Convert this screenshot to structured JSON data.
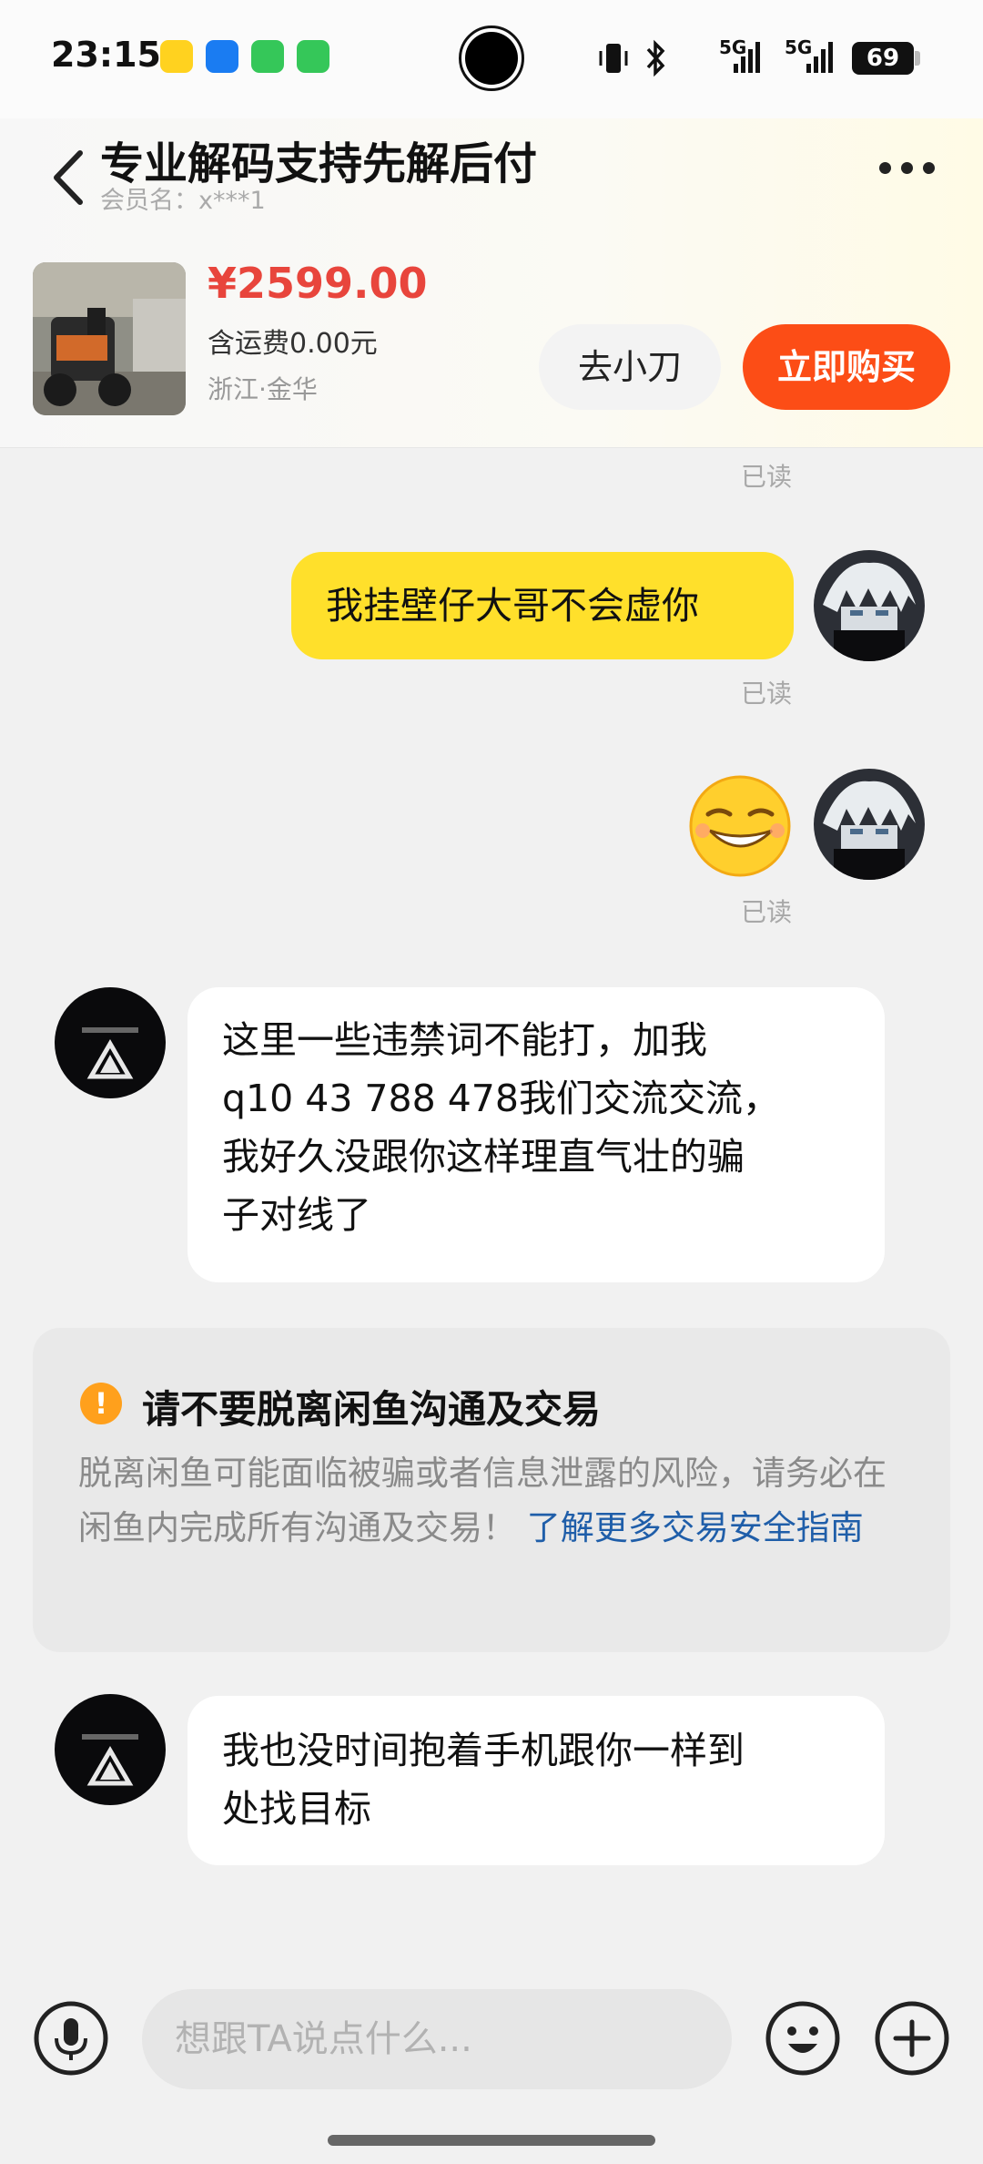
{
  "status": {
    "time": "23:15",
    "net1": "5G",
    "net2": "5G",
    "battery": "69",
    "apps": [
      {
        "name": "duoduo-app-icon",
        "color": "#ffd21f"
      },
      {
        "name": "router-app-icon",
        "color": "#1a7cf2"
      },
      {
        "name": "messages-app-icon",
        "color": "#35c759"
      },
      {
        "name": "phone-app-icon",
        "color": "#35c759"
      }
    ]
  },
  "header": {
    "title": "专业解码支持先解后付",
    "member": "会员名：x***1",
    "price": "¥2599.00",
    "shipping": "含运费0.00元",
    "location": "浙江·金华",
    "knife_button": "去小刀",
    "buy_button": "立即购买"
  },
  "chat": {
    "read_label": "已读",
    "messages": [
      {
        "from": "me",
        "text": "我挂壁仔大哥不会虚你"
      },
      {
        "from": "me",
        "emoji": "grin-sly"
      },
      {
        "from": "other",
        "lines": [
          "这里一些违禁词不能打，加我",
          "q10 43 788 478我们交流交流，",
          "我好久没跟你这样理直气壮的骗",
          "子对线了"
        ]
      },
      {
        "from": "other",
        "lines": [
          "我也没时间抱着手机跟你一样到",
          "处找目标"
        ]
      }
    ],
    "warning": {
      "title": "请不要脱离闲鱼沟通及交易",
      "body": "脱离闲鱼可能面临被骗或者信息泄露的风险，请务必在闲鱼内完成所有沟通及交易！",
      "link": "了解更多交易安全指南"
    }
  },
  "input": {
    "placeholder": "想跟TA说点什么..."
  },
  "colors": {
    "accent_yellow": "#ffe02b",
    "buy_orange": "#fc4d16",
    "price_red": "#e8453c",
    "link_blue": "#1f5ea9",
    "warning_orange": "#ffa01c"
  }
}
